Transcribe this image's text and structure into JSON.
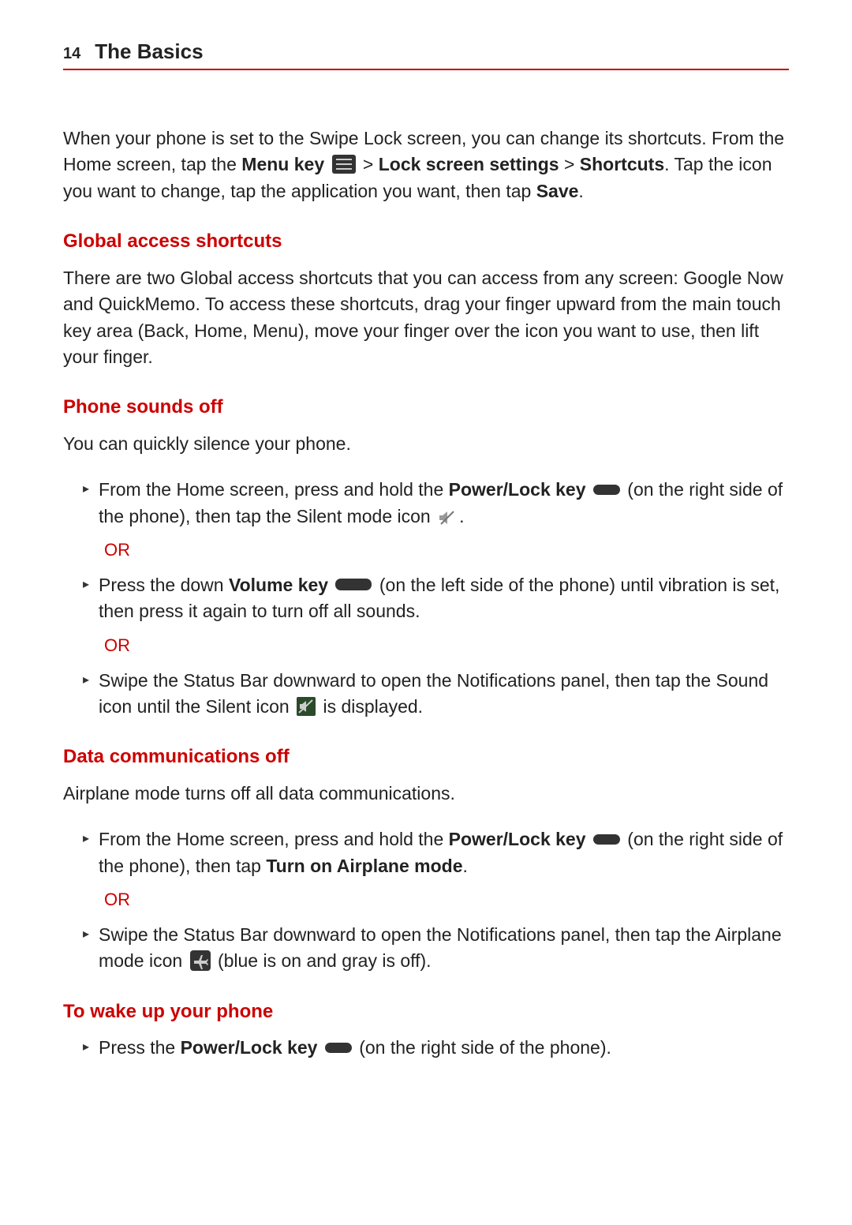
{
  "header": {
    "page_number": "14",
    "section": "The Basics"
  },
  "intro": {
    "p1_a": "When your phone is set to the Swipe Lock screen, you can change its shortcuts. From the Home screen, tap the ",
    "menu_key": "Menu key",
    "gt1": " > ",
    "lock_screen_settings": "Lock screen settings",
    "gt2": " > ",
    "shortcuts": "Shortcuts",
    "p1_b": ". Tap the icon you want to change, tap the application you want, then tap ",
    "save": "Save",
    "p1_c": "."
  },
  "global": {
    "title": "Global access shortcuts",
    "body": "There are two Global access shortcuts that you can access from any screen: Google Now and QuickMemo. To access these shortcuts, drag your finger upward from the main touch key area (Back, Home, Menu), move your finger over the icon you want to use, then lift your finger."
  },
  "sounds": {
    "title": "Phone sounds off",
    "intro": "You can quickly silence your phone.",
    "b1_a": "From the Home screen, press and hold the ",
    "pwr": "Power/Lock key",
    "b1_b": " (on the right side of the phone), then tap the Silent mode icon ",
    "b1_c": ".",
    "or": "OR",
    "b2_a": "Press the down ",
    "vol": "Volume key",
    "b2_b": " (on the left side of the phone) until vibration is set, then press it again to turn off all sounds.",
    "b3_a": "Swipe the Status Bar downward to open the Notifications panel, then tap the Sound icon until the Silent icon ",
    "b3_b": " is displayed."
  },
  "data": {
    "title": "Data communications off",
    "intro": "Airplane mode turns off all data communications.",
    "b1_a": "From the Home screen, press and hold the ",
    "pwr": "Power/Lock key",
    "b1_b": " (on the right side of the phone), then tap ",
    "turn_on": "Turn on Airplane mode",
    "b1_c": ".",
    "or": "OR",
    "b2_a": "Swipe the Status Bar downward to open the Notifications panel, then tap the Airplane mode icon ",
    "b2_b": " (blue is on and gray is off)."
  },
  "wake": {
    "title": "To wake up your phone",
    "b1_a": "Press the ",
    "pwr": "Power/Lock key",
    "b1_b": " (on the right side of the phone)."
  }
}
